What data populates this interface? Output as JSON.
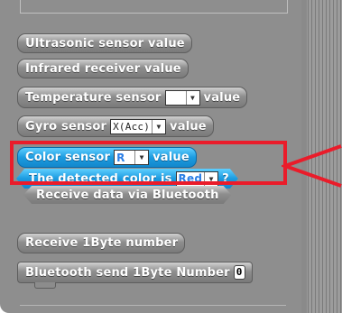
{
  "palette": {
    "blocks": [
      {
        "label": "Ultrasonic sensor value"
      },
      {
        "label": "Infrared receiver value"
      },
      {
        "label": "Temperature sensor",
        "dropdown": "",
        "suffix": "value"
      },
      {
        "label": "Gyro sensor",
        "dropdown": "X(Acc)",
        "suffix": "value"
      },
      {
        "label": "Color sensor",
        "dropdown": "R",
        "suffix": "value"
      },
      {
        "label": "The detected color is",
        "dropdown": "Red",
        "suffix": "?"
      },
      {
        "label": "Receive data via Bluetooth"
      },
      {
        "label": "Receive 1Byte number"
      },
      {
        "label": "Bluetooth send 1Byte Number",
        "input": "0"
      }
    ]
  },
  "colors": {
    "highlight": "#ea1c2a",
    "blue_block": "#1c9be0",
    "gray_block": "#8e8e8e"
  },
  "icons": {
    "pointer": "red-arrow-icon",
    "dropdown": "dropdown-arrow-icon"
  }
}
